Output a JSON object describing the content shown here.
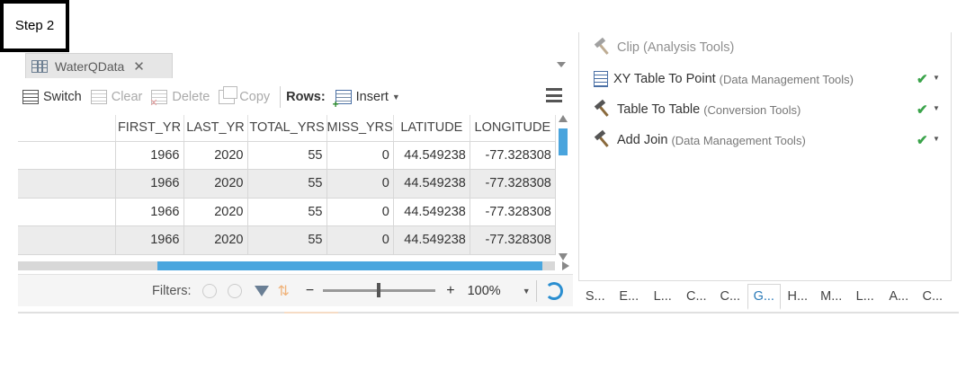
{
  "step_label": "Step 2",
  "document_tab": {
    "title": "WaterQData",
    "close": "✕"
  },
  "toolbar": {
    "switch": "Switch",
    "clear": "Clear",
    "delete": "Delete",
    "copy": "Copy",
    "rows_label": "Rows:",
    "insert": "Insert"
  },
  "table": {
    "columns": [
      "FIRST_YR",
      "LAST_YR",
      "TOTAL_YRS",
      "MISS_YRS",
      "LATITUDE",
      "LONGITUDE"
    ],
    "rows": [
      [
        "1966",
        "2020",
        "55",
        "0",
        "44.549238",
        "-77.328308"
      ],
      [
        "1966",
        "2020",
        "55",
        "0",
        "44.549238",
        "-77.328308"
      ],
      [
        "1966",
        "2020",
        "55",
        "0",
        "44.549238",
        "-77.328308"
      ],
      [
        "1966",
        "2020",
        "55",
        "0",
        "44.549238",
        "-77.328308"
      ]
    ]
  },
  "statusbar": {
    "filters": "Filters:",
    "minus": "−",
    "plus": "+",
    "zoom": "100%"
  },
  "history": {
    "clip_partial": "Clip (Analysis Tools)",
    "items": [
      {
        "name": "XY Table To Point",
        "sub": "(Data Management Tools)",
        "icon": "script-icon"
      },
      {
        "name": "Table To Table",
        "sub": "(Conversion Tools)",
        "icon": "hammer-icon"
      },
      {
        "name": "Add Join",
        "sub": "(Data Management Tools)",
        "icon": "hammer-icon"
      }
    ],
    "check": "✔"
  },
  "bottom_tabs": [
    "S...",
    "E...",
    "L...",
    "C...",
    "C...",
    "G...",
    "H...",
    "M...",
    "L...",
    "A...",
    "C..."
  ],
  "colors": {
    "accent": "#49a4dd",
    "check": "#3aa34a"
  }
}
